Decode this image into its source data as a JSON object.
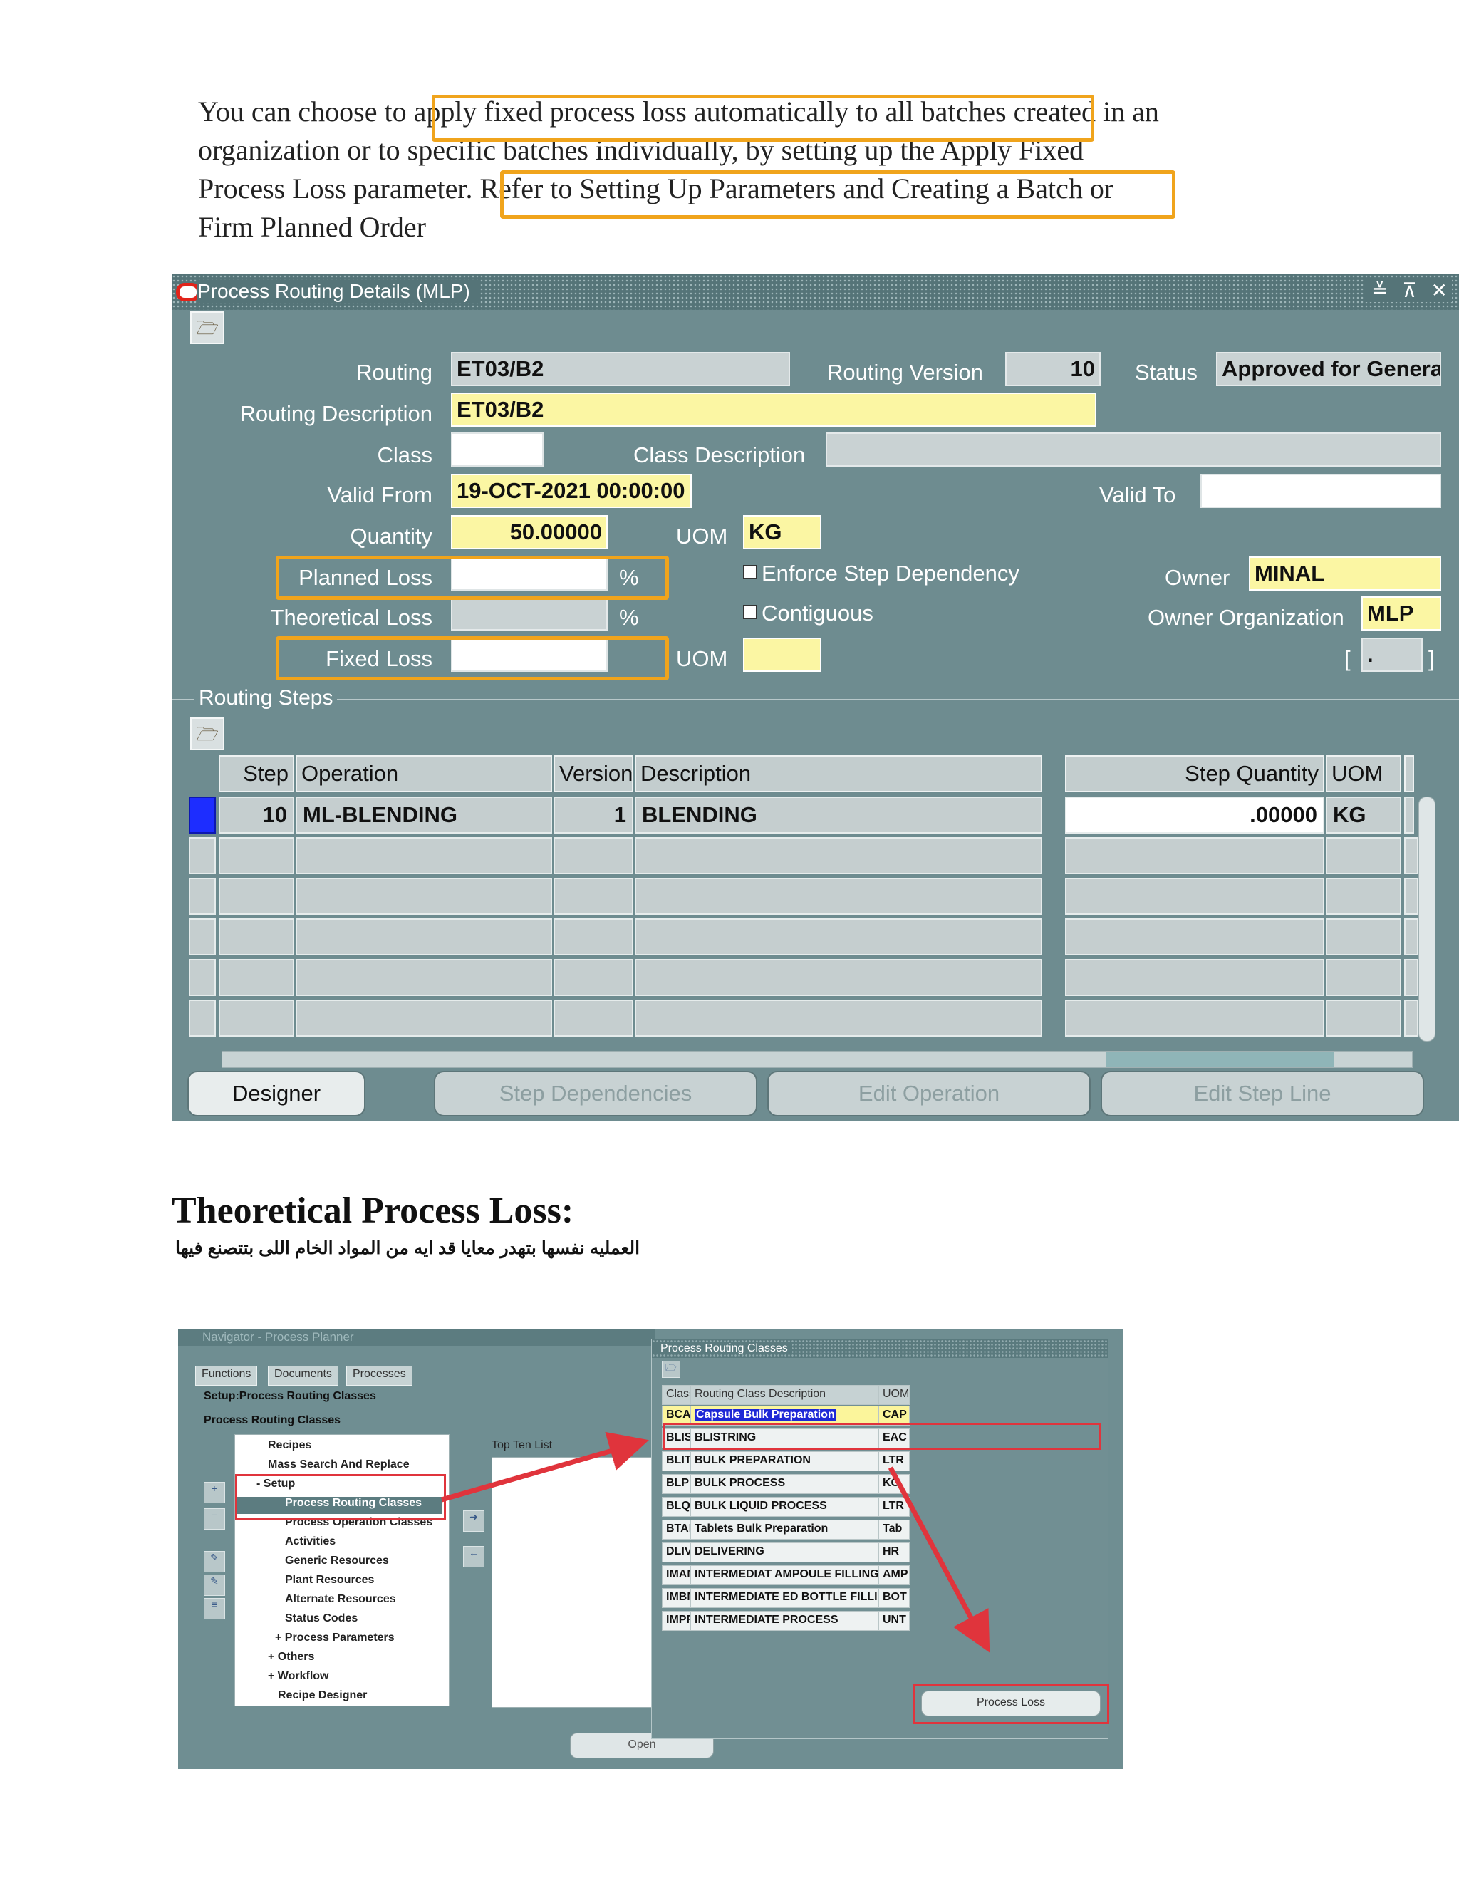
{
  "intro": {
    "line1": "You can choose to apply fixed process loss automatically to all batches created in an",
    "line2": "organization or to specific batches individually, by setting up the Apply Fixed",
    "line3": "Process Loss parameter. Refer to Setting Up Parameters and Creating a Batch or",
    "line4": "Firm Planned Order"
  },
  "routing_window": {
    "title": "Process Routing Details (MLP)",
    "window_controls": "≚ ⊼ ✕",
    "toolbar_icon": "folder-icon",
    "fields": {
      "routing_label": "Routing",
      "routing_value": "ET03/B2",
      "routing_version_label": "Routing Version",
      "routing_version_value": "10",
      "status_label": "Status",
      "status_value": "Approved for Genera",
      "routing_description_label": "Routing Description",
      "routing_description_value": "ET03/B2",
      "class_label": "Class",
      "class_value": "",
      "class_description_label": "Class Description",
      "class_description_value": "",
      "valid_from_label": "Valid From",
      "valid_from_value": "19-OCT-2021 00:00:00",
      "valid_to_label": "Valid To",
      "valid_to_value": "",
      "quantity_label": "Quantity",
      "quantity_value": "50.00000",
      "uom_label": "UOM",
      "uom_value": "KG",
      "planned_loss_label": "Planned Loss",
      "planned_loss_value": "",
      "percent1": "%",
      "theoretical_loss_label": "Theoretical Loss",
      "theoretical_loss_value": "",
      "percent2": "%",
      "fixed_loss_label": "Fixed Loss",
      "fixed_loss_value": "",
      "fixed_uom_label": "UOM",
      "fixed_uom_value": "",
      "enforce_step_label": "Enforce Step Dependency",
      "contiguous_label": "Contiguous",
      "owner_label": "Owner",
      "owner_value": "MINAL",
      "owner_org_label": "Owner Organization",
      "owner_org_value": "MLP",
      "flex_open": "[",
      "flex_value": ".",
      "flex_close": "]"
    },
    "routing_steps": {
      "label": "Routing Steps",
      "columns": [
        "Step",
        "Operation",
        "Version",
        "Description",
        "Step Quantity",
        "UOM"
      ],
      "rows": [
        {
          "step": "10",
          "operation": "ML-BLENDING",
          "version": "1",
          "description": "BLENDING",
          "step_quantity": ".00000",
          "uom": "KG"
        }
      ]
    },
    "buttons": {
      "designer": "Designer",
      "step_dependencies": "Step Dependencies",
      "edit_operation": "Edit Operation",
      "edit_step_line": "Edit Step Line"
    }
  },
  "section": {
    "heading": "Theoretical Process Loss:",
    "arabic": "العمليه نفسها بتهدر معايا قد ايه من المواد الخام اللى بتتصنع فيها"
  },
  "navigator": {
    "title": "Navigator - Process Planner",
    "tabs": [
      "Functions",
      "Documents",
      "Processes"
    ],
    "path": "Setup:Process Routing Classes",
    "subtitle": "Process Routing Classes",
    "top_ten_label": "Top Ten List",
    "items": [
      "Recipes",
      "Mass Search And Replace",
      "- Setup",
      "Process Routing Classes",
      "Process Operation Classes",
      "Activities",
      "Generic Resources",
      "Plant Resources",
      "Alternate Resources",
      "Status Codes",
      "+ Process Parameters",
      "+ Others",
      "+ Workflow",
      "Recipe Designer"
    ],
    "open_button": "Open"
  },
  "classes_window": {
    "title": "Process Routing Classes",
    "columns": [
      "Class",
      "Routing Class Description",
      "UOM"
    ],
    "rows": [
      [
        "BCAP",
        "Capsule Bulk Preparation",
        "CAP"
      ],
      [
        "BLIS",
        "BLISTRING",
        "EAC"
      ],
      [
        "BLIT",
        "BULK PREPARATION",
        "LTR"
      ],
      [
        "BLPR",
        "BULK PROCESS",
        "KG"
      ],
      [
        "BLQP",
        "BULK LIQUID PROCESS",
        "LTR"
      ],
      [
        "BTAB",
        "Tablets Bulk Preparation",
        "Tab"
      ],
      [
        "DLIV",
        "DELIVERING",
        "HR"
      ],
      [
        "IMAM",
        "INTERMEDIAT AMPOULE FILLING",
        "AMP"
      ],
      [
        "IMBM",
        "INTERMEDIATE ED BOTTLE FILLING",
        "BOT"
      ],
      [
        "IMPR",
        "INTERMEDIATE PROCESS",
        "UNT"
      ]
    ],
    "process_loss_button": "Process Loss"
  }
}
